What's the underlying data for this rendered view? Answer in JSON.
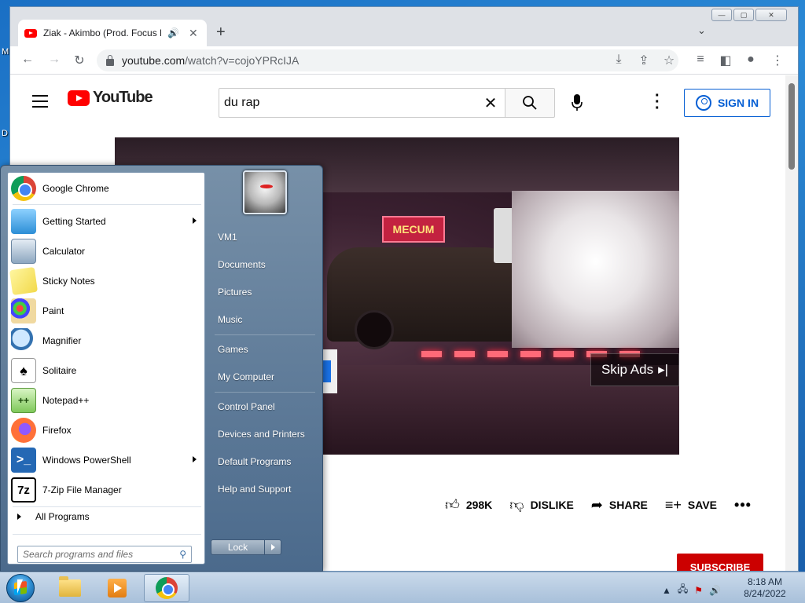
{
  "desktop": {
    "letter_m": "M",
    "letter_d": "D"
  },
  "browser": {
    "tab_title": "Ziak - Akimbo (Prod. Focus B",
    "tab_audio_icon": "speaker-icon",
    "new_tab": "+",
    "tab_search": "⌄",
    "url_host": "youtube.com",
    "url_path": "/watch?v=cojoYPRcIJA",
    "window_min": "—",
    "window_max": "▢",
    "window_close": "✕"
  },
  "youtube": {
    "logo_text": "YouTube",
    "search_value": "du rap",
    "sign_in": "SIGN IN",
    "skip_ads": "Skip Ads",
    "video_sign": "MECUM",
    "actions": {
      "like_count": "298K",
      "dislike": "DISLIKE",
      "share": "SHARE",
      "save": "SAVE"
    },
    "subscribe": "SUBSCRIBE"
  },
  "start_menu": {
    "pinned": [
      {
        "label": "Google Chrome",
        "icon": "chrome-icon"
      },
      {
        "label": "Getting Started",
        "icon": "getting-started-icon",
        "submenu": true
      },
      {
        "label": "Calculator",
        "icon": "calculator-icon"
      },
      {
        "label": "Sticky Notes",
        "icon": "sticky-notes-icon"
      },
      {
        "label": "Paint",
        "icon": "paint-icon"
      },
      {
        "label": "Magnifier",
        "icon": "magnifier-icon"
      },
      {
        "label": "Solitaire",
        "icon": "solitaire-icon"
      },
      {
        "label": "Notepad++",
        "icon": "notepadpp-icon"
      },
      {
        "label": "Firefox",
        "icon": "firefox-icon"
      },
      {
        "label": "Windows PowerShell",
        "icon": "powershell-icon",
        "submenu": true
      },
      {
        "label": "7-Zip File Manager",
        "icon": "7zip-icon"
      }
    ],
    "all_programs": "All Programs",
    "search_placeholder": "Search programs and files",
    "right_links": {
      "user": "VM1",
      "documents": "Documents",
      "pictures": "Pictures",
      "music": "Music",
      "games": "Games",
      "computer": "My Computer",
      "control_panel": "Control Panel",
      "devices": "Devices and Printers",
      "default_programs": "Default Programs",
      "help": "Help and Support"
    },
    "lock_label": "Lock"
  },
  "taskbar": {
    "clock_time": "8:18 AM",
    "clock_date": "8/24/2022",
    "tray_icons": [
      "show-hidden-icon",
      "network-icon",
      "action-center-icon",
      "volume-icon"
    ]
  },
  "colors": {
    "yt_red": "#ff0000",
    "yt_blue": "#065fd4",
    "subscribe_red": "#cc0000"
  }
}
